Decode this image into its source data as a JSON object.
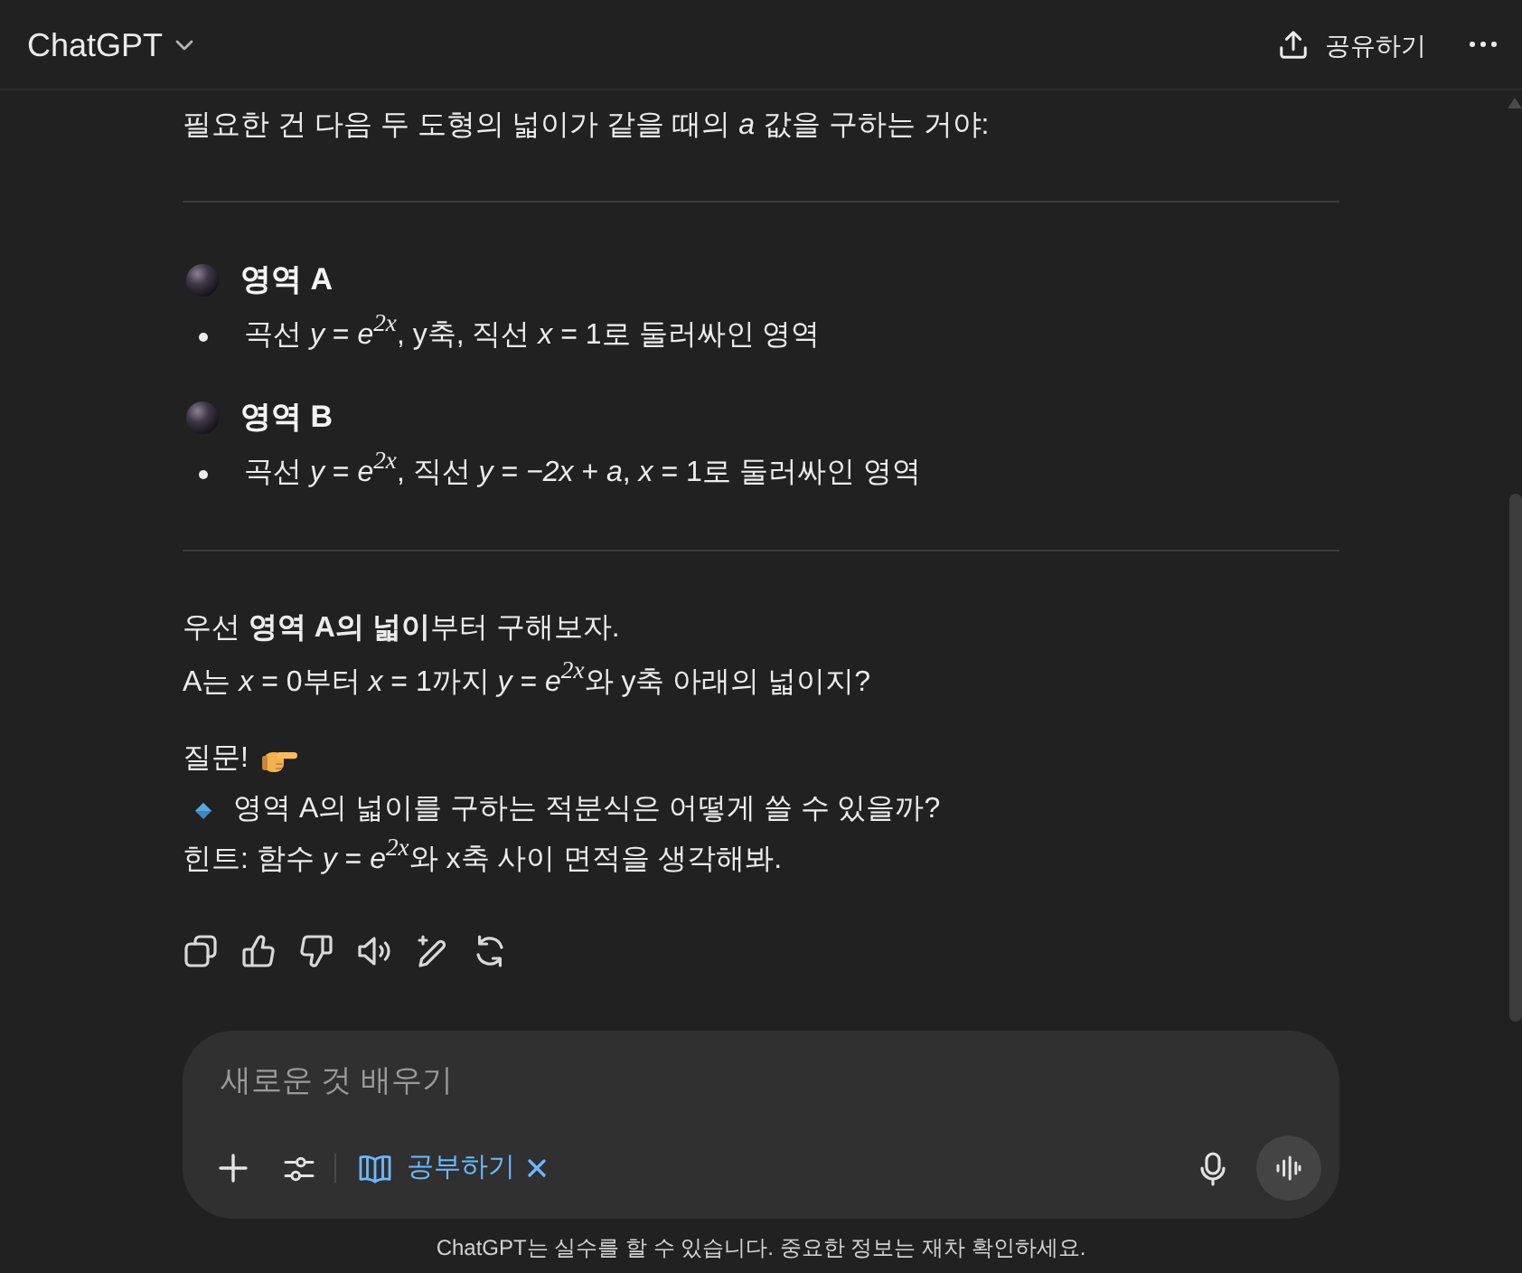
{
  "header": {
    "title": "ChatGPT",
    "share_label": "공유하기"
  },
  "message": {
    "intro": "필요한 건 다음 두 도형의 넓이가 같을 때의 *a* 값을 구하는 거야:",
    "regions": [
      {
        "heading": "영역 A",
        "bullets": [
          "곡선 *y* = *e*$^{2x}$, y축, 직선 *x* = 1로 둘러싸인 영역"
        ]
      },
      {
        "heading": "영역 B",
        "bullets": [
          "곡선 *y* = *e*$^{2x}$, 직선 *y* = *−2x* + *a*, *x* = 1로 둘러싸인 영역"
        ]
      }
    ],
    "explanation": [
      "우선 **영역 A의 넓이**부터 구해보자.",
      "A는 *x* = 0부터 *x* = 1까지 *y* = *e*$^{2x}$와 y축 아래의 넓이지?"
    ],
    "question": {
      "label": "질문!",
      "items": [
        "영역 A의 넓이를 구하는 적분식은 어떻게 쓸 수 있을까?"
      ]
    },
    "hint": "힌트: 함수 *y* = *e*$^{2x}$와 x축 사이 면적을 생각해봐."
  },
  "composer": {
    "placeholder": "새로운 것 배우기",
    "tool_chip": {
      "label": "공부하기"
    }
  },
  "disclaimer": "ChatGPT는 실수를 할 수 있습니다. 중요한 정보는 재차 확인하세요."
}
